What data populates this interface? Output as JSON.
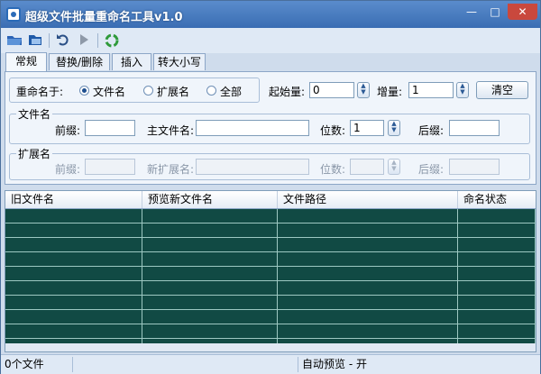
{
  "window": {
    "title": "超级文件批量重命名工具v1.0",
    "min": "—",
    "max": "□",
    "close": "✕"
  },
  "toolbar": {
    "icons": [
      "open-folder-icon",
      "open-file-icon",
      "undo-icon",
      "run-icon",
      "recycle-icon"
    ]
  },
  "tabs": [
    {
      "label": "常规",
      "active": true
    },
    {
      "label": "替换/删除",
      "active": false
    },
    {
      "label": "插入",
      "active": false
    },
    {
      "label": "转大小写",
      "active": false
    }
  ],
  "general": {
    "rename_label": "重命名于:",
    "options": [
      {
        "label": "文件名",
        "checked": true
      },
      {
        "label": "扩展名",
        "checked": false
      },
      {
        "label": "全部",
        "checked": false
      }
    ],
    "start_label": "起始量:",
    "start_value": "0",
    "step_label": "增量:",
    "step_value": "1",
    "clear_label": "清空"
  },
  "filename_group": {
    "title": "文件名",
    "prefix_label": "前缀:",
    "prefix_value": "",
    "main_label": "主文件名:",
    "main_value": "",
    "digits_label": "位数:",
    "digits_value": "1",
    "suffix_label": "后缀:",
    "suffix_value": ""
  },
  "ext_group": {
    "title": "扩展名",
    "prefix_label": "前缀:",
    "new_ext_label": "新扩展名:",
    "digits_label": "位数:",
    "suffix_label": "后缀:"
  },
  "grid": {
    "columns": [
      "旧文件名",
      "预览新文件名",
      "文件路径",
      "命名状态"
    ],
    "row_count": 10
  },
  "status": {
    "file_count": "0个文件",
    "preview": "自动预览 - 开"
  },
  "colors": {
    "grid_bg": "#114a44",
    "title_bar": "#3a6db3"
  }
}
